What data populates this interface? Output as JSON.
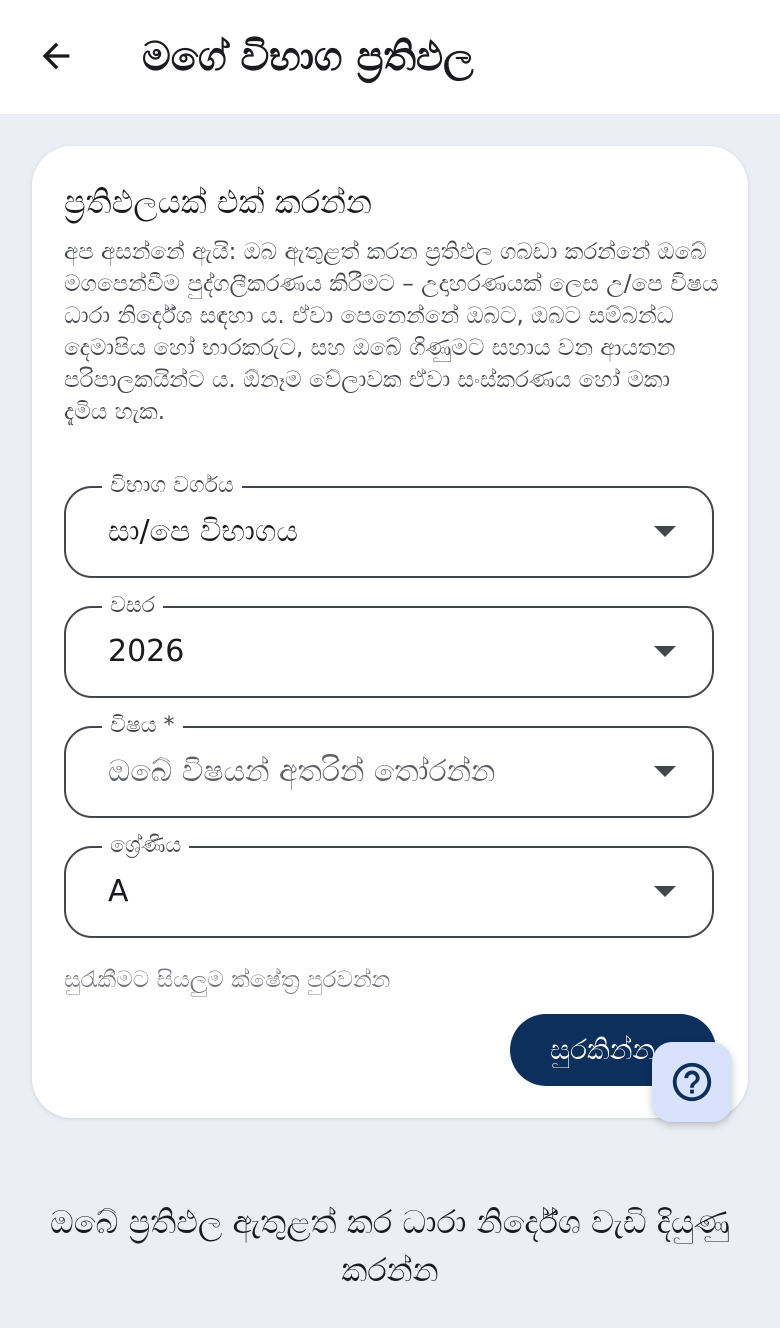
{
  "app_bar": {
    "title": "මගේ විභාග ප්‍රතිඵල",
    "back_icon": "arrow-left-icon"
  },
  "card": {
    "title": "ප්‍රතිඵලයක් එක් කරන්න",
    "description": "අප අසන්නේ ඇයි: ඔබ ඇතුළත් කරන ප්‍රතිඵල ගබඩා කරන්නේ ඔබේ මගපෙන්වීම පුද්ගලීකරණය කිරීමට – උදාහරණයක් ලෙස උ/පෙ විෂය ධාරා නිර්දේශ සඳහා ය. ඒවා පෙනෙන්නේ ඔබට, ඔබට සම්බන්ධ දෙමාපිය හෝ භාරකරුට, සහ ඔබේ ගිණුමට සහාය වන ආයතන පරිපාලකයින්ට ය. ඕනෑම වේලාවක ඒවා සංස්කරණය හෝ මකා දැමිය හැක.",
    "fields": [
      {
        "label": "විභාග වර්ගය",
        "value": "සා/පෙ විභාගය",
        "is_placeholder": false
      },
      {
        "label": "වසර",
        "value": "2026",
        "is_placeholder": false
      },
      {
        "label": "විෂය *",
        "value": "ඔබේ විෂයන් අතරින් තෝරන්න",
        "is_placeholder": true
      },
      {
        "label": "ශ්‍රේණිය",
        "value": "A",
        "is_placeholder": false
      }
    ],
    "helper_text": "සුරැකීමට සියලුම ක්ෂේත්‍ර පුරවන්න",
    "save_label": "සුරකින්න"
  },
  "help_fab": {
    "icon": "help-circle-icon"
  },
  "footer": {
    "text": "ඔබේ ප්‍රතිඵල ඇතුළත් කර ධාරා නිර්දේශ වැඩි දියුණු කරන්න"
  },
  "colors": {
    "background": "#ebeff5",
    "primary_button": "#0c2f5c",
    "fab_background": "#d8e2fb",
    "fab_icon": "#0c2f5c"
  }
}
